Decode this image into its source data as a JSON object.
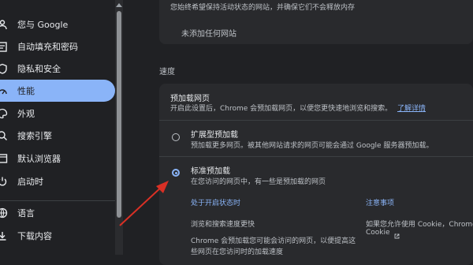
{
  "sidebar": {
    "items": [
      {
        "label": "您与 Google",
        "icon": "person-icon"
      },
      {
        "label": "自动填充和密码",
        "icon": "assignment-icon"
      },
      {
        "label": "隐私和安全",
        "icon": "shield-icon"
      },
      {
        "label": "性能",
        "icon": "speedometer-icon"
      },
      {
        "label": "外观",
        "icon": "palette-icon"
      },
      {
        "label": "搜索引擎",
        "icon": "search-icon"
      },
      {
        "label": "默认浏览器",
        "icon": "browser-icon"
      },
      {
        "label": "启动时",
        "icon": "power-icon"
      },
      {
        "label": "语言",
        "icon": "globe-icon"
      },
      {
        "label": "下载内容",
        "icon": "download-icon"
      }
    ],
    "active_index": 3
  },
  "top_card": {
    "truncated_text": "您始终希望保持活动状态的网站，并确保它们不会释放内存",
    "empty_text": "未添加任何网站"
  },
  "speed": {
    "section_title": "速度",
    "preload_title": "预加载网页",
    "preload_desc": "开启此设置后，Chrome 会预加载网页，以便您更快速地浏览和搜索。",
    "learn_more": "了解详情",
    "option1_title": "扩展型预加载",
    "option1_desc": "预加载更多网页。被其他网站请求的网页可能会通过 Google 服务器预加载。",
    "option2_title": "标准预加载",
    "option2_desc": "在您访问的网页中，有一些是预加载的网页",
    "when_on_heading": "处于开启状态时",
    "notes_heading": "注意事项",
    "benefit1": "浏览和搜索速度更快",
    "benefit2_line1": "Chrome 会预加载您可能会访问的网页，以便提高这",
    "benefit2_line2": "些网页在您访问时的加载速度",
    "note1_line1": "如果您允许使用 Cookie，Chrome",
    "note1_line2": "Cookie",
    "selected_option": "标准预加载"
  },
  "colors": {
    "accent": "#8ab4f8",
    "background": "#202124",
    "card": "#292a2d",
    "annotation_arrow": "#d93025"
  }
}
